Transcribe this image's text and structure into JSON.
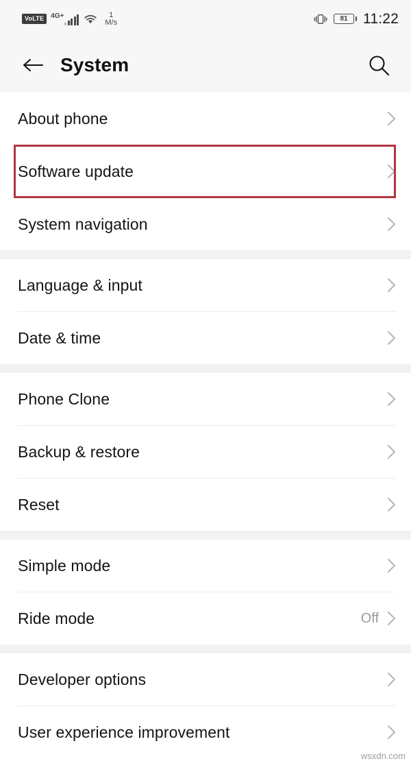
{
  "statusbar": {
    "volte_label": "VoLTE",
    "network_type": "4G+",
    "speed_value": "1",
    "speed_unit": "M/s",
    "battery_level": "81",
    "time": "11:22",
    "icons": {
      "signal": "signal-bars-icon",
      "wifi": "wifi-icon",
      "vibrate": "vibrate-icon",
      "battery": "battery-icon"
    }
  },
  "appbar": {
    "back_label": "back-arrow",
    "title": "System",
    "search_label": "search"
  },
  "highlight": {
    "color": "#b03641",
    "target": "Software update"
  },
  "groups": [
    {
      "rows": [
        {
          "label": "About phone",
          "value": "",
          "highlighted": false
        },
        {
          "label": "Software update",
          "value": "",
          "highlighted": true
        },
        {
          "label": "System navigation",
          "value": "",
          "highlighted": false
        }
      ]
    },
    {
      "rows": [
        {
          "label": "Language & input",
          "value": "",
          "highlighted": false
        },
        {
          "label": "Date & time",
          "value": "",
          "highlighted": false
        }
      ]
    },
    {
      "rows": [
        {
          "label": "Phone Clone",
          "value": "",
          "highlighted": false
        },
        {
          "label": "Backup & restore",
          "value": "",
          "highlighted": false
        },
        {
          "label": "Reset",
          "value": "",
          "highlighted": false
        }
      ]
    },
    {
      "rows": [
        {
          "label": "Simple mode",
          "value": "",
          "highlighted": false
        },
        {
          "label": "Ride mode",
          "value": "Off",
          "highlighted": false
        }
      ]
    },
    {
      "rows": [
        {
          "label": "Developer options",
          "value": "",
          "highlighted": false
        },
        {
          "label": "User experience improvement",
          "value": "",
          "highlighted": false
        }
      ]
    }
  ],
  "watermark": "wsxdn.com"
}
